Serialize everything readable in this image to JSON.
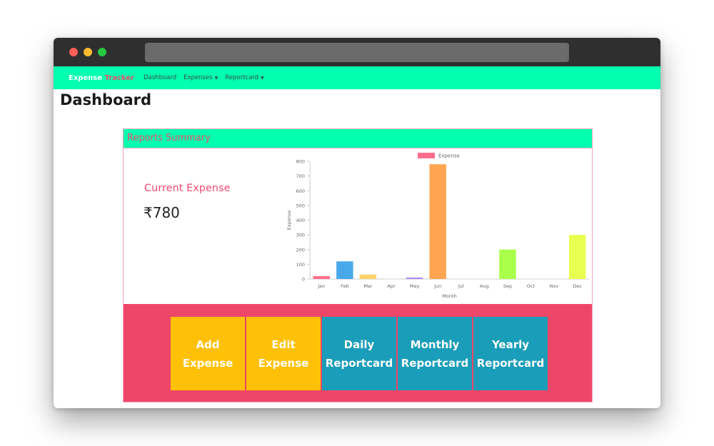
{
  "app": {
    "brand_first": "Expense",
    "brand_second": "Tracker"
  },
  "nav": {
    "items": [
      {
        "label": "Dashboard",
        "dropdown": false
      },
      {
        "label": "Expenses",
        "dropdown": true
      },
      {
        "label": "Reportcard",
        "dropdown": true
      }
    ]
  },
  "page": {
    "title": "Dashboard"
  },
  "summary": {
    "header": "Reports Summary",
    "expense_label": "Current Expense",
    "expense_value": "₹780"
  },
  "actions": [
    {
      "line1": "Add",
      "line2": "Expense",
      "style": "yellow"
    },
    {
      "line1": "Edit",
      "line2": "Expense",
      "style": "yellow"
    },
    {
      "line1": "Daily",
      "line2": "Reportcard",
      "style": "teal"
    },
    {
      "line1": "Monthly",
      "line2": "Reportcard",
      "style": "teal"
    },
    {
      "line1": "Yearly",
      "line2": "Reportcard",
      "style": "teal"
    }
  ],
  "colors": {
    "navbar": "#00ffae",
    "accent": "#ee4b73",
    "button_yellow": "#ffc107",
    "button_teal": "#1a9db8"
  },
  "chart_data": {
    "type": "bar",
    "categories": [
      "Jan",
      "Feb",
      "Mar",
      "Apr",
      "May",
      "Jun",
      "Jul",
      "Aug",
      "Sep",
      "Oct",
      "Nov",
      "Dec"
    ],
    "series": [
      {
        "name": "Expense",
        "values": [
          20,
          120,
          30,
          0,
          10,
          780,
          0,
          0,
          200,
          0,
          0,
          300
        ]
      }
    ],
    "bar_colors": [
      "#ff6f8d",
      "#4aa9ea",
      "#ffd36b",
      "#cccccc",
      "#a98cf0",
      "#ffa552",
      "#cccccc",
      "#cccccc",
      "#aaff4a",
      "#cccccc",
      "#cccccc",
      "#e8ff52"
    ],
    "legend_color": "#ff6f8d",
    "title": "",
    "xlabel": "Month",
    "ylabel": "Expense",
    "ylim": [
      0,
      800
    ],
    "yticks": [
      0,
      100,
      200,
      300,
      400,
      500,
      600,
      700,
      800
    ],
    "legend_position": "top-center",
    "grid": false
  }
}
